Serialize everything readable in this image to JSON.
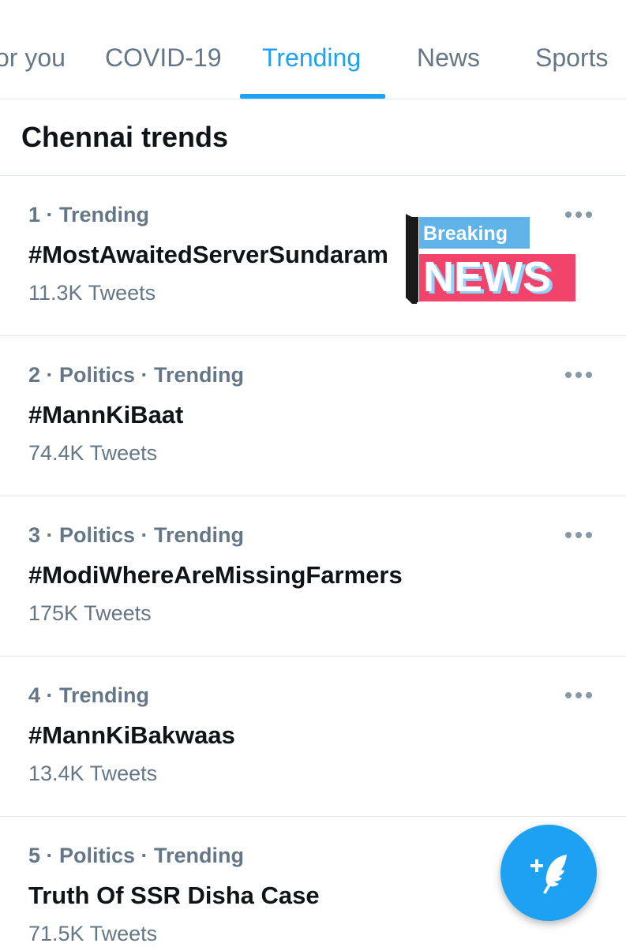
{
  "tabs": [
    {
      "label": "or you",
      "active": false
    },
    {
      "label": "COVID-19",
      "active": false
    },
    {
      "label": "Trending",
      "active": true
    },
    {
      "label": "News",
      "active": false
    },
    {
      "label": "Sports",
      "active": false
    }
  ],
  "section": {
    "title": "Chennai trends"
  },
  "trends": [
    {
      "meta": "1 · Trending",
      "name": "#MostAwaitedServerSundaram",
      "count": "11.3K Tweets"
    },
    {
      "meta": "2 · Politics · Trending",
      "name": "#MannKiBaat",
      "count": "74.4K Tweets"
    },
    {
      "meta": "3 · Politics · Trending",
      "name": "#ModiWhereAreMissingFarmers",
      "count": "175K Tweets"
    },
    {
      "meta": "4 · Trending",
      "name": "#MannKiBakwaas",
      "count": "13.4K Tweets"
    },
    {
      "meta": "5 · Politics · Trending",
      "name": "Truth Of SSR Disha Case",
      "count": "71.5K Tweets"
    }
  ],
  "news_image": {
    "line1": "Breaking",
    "line2": "NEWS"
  },
  "icons": {
    "more": "more-icon",
    "compose": "compose-tweet-icon"
  },
  "colors": {
    "accent": "#1da1f2",
    "text": "#0f1419",
    "secondary": "#657786",
    "divider": "#e1e8ed",
    "breaking_bg": "#5fb3e8",
    "news_bg": "#f2446b"
  }
}
